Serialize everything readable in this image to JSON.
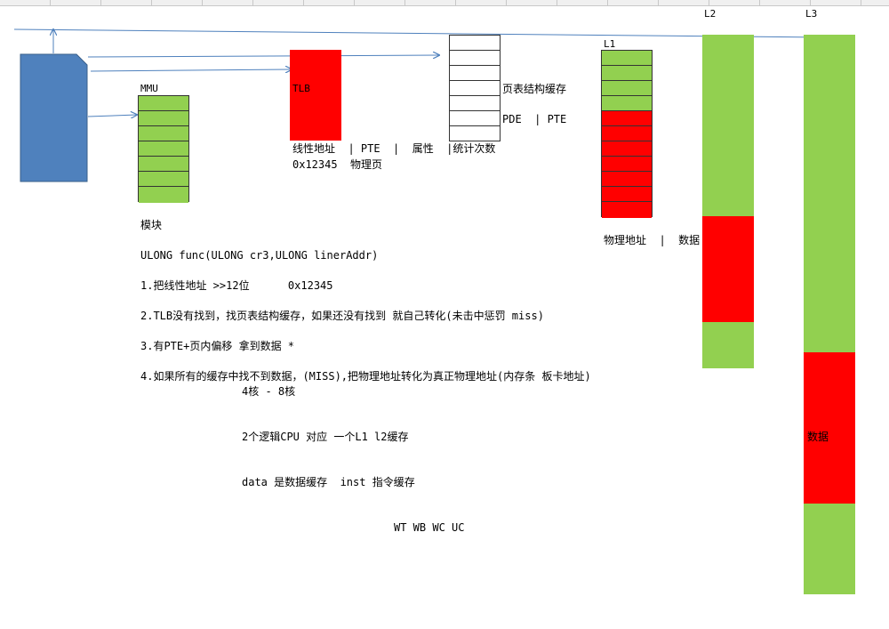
{
  "colors": {
    "green": "#92d050",
    "red": "#ff0000",
    "blue_shape": "#4f81bd",
    "arrow": "#4f81bd"
  },
  "labels": {
    "mmu": "MMU",
    "tlb": "TLB",
    "l1": "L1",
    "l2": "L2",
    "l3": "L3",
    "page_struct_cache": "页表结构缓存",
    "pde_pte": "PDE  | PTE",
    "tlb_fields": "线性地址  | PTE  |  属性  |统计次数",
    "tlb_example": "0x12345  物理页",
    "l1_fields": "物理地址  |  数据",
    "l3_data": "数据"
  },
  "notes": {
    "module": "模块",
    "func_sig": "ULONG func(ULONG cr3,ULONG linerAddr)",
    "step1": "1.把线性地址 >>12位      0x12345",
    "step2": "2.TLB没有找到，找页表结构缓存，如果还没有找到 就自己转化(未击中惩罚 miss)",
    "step3": "3.有PTE+页内偏移 拿到数据 *",
    "step4": "4.如果所有的缓存中找不到数据，(MISS),把物理地址转化为真正物理地址(内存条 板卡地址)",
    "cores": "4核 - 8核",
    "logical_cpu": "2个逻辑CPU 对应 一个L1 l2缓存",
    "data_inst": "data 是数据缓存  inst 指令缓存",
    "cache_types": "WT WB WC UC"
  }
}
